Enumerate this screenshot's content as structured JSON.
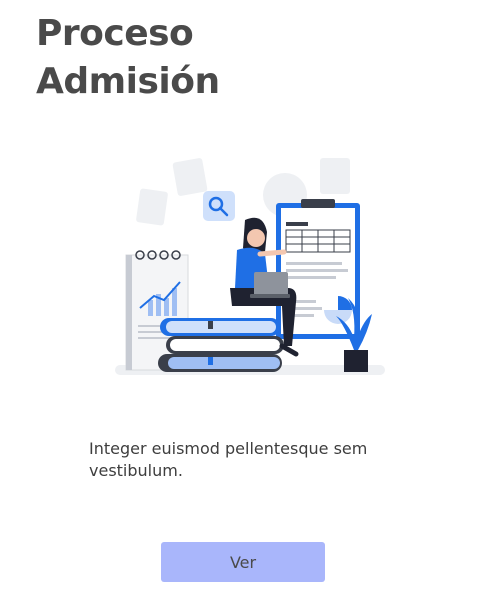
{
  "page": {
    "title_line1": "Proceso",
    "title_line2": "Admisión",
    "description": "Integer euismod pellentesque sem vestibulum.",
    "button_label": "Ver"
  },
  "colors": {
    "title": "#4a4a4a",
    "accent_blue": "#1f6fe5",
    "button_bg": "#a9b6fb",
    "text": "#3e3e3e"
  },
  "illustration": {
    "icons": [
      "magnifier-icon",
      "clipboard-icon",
      "notebook-icon",
      "books-stack",
      "laptop-icon",
      "plant-icon",
      "person-figure"
    ]
  }
}
